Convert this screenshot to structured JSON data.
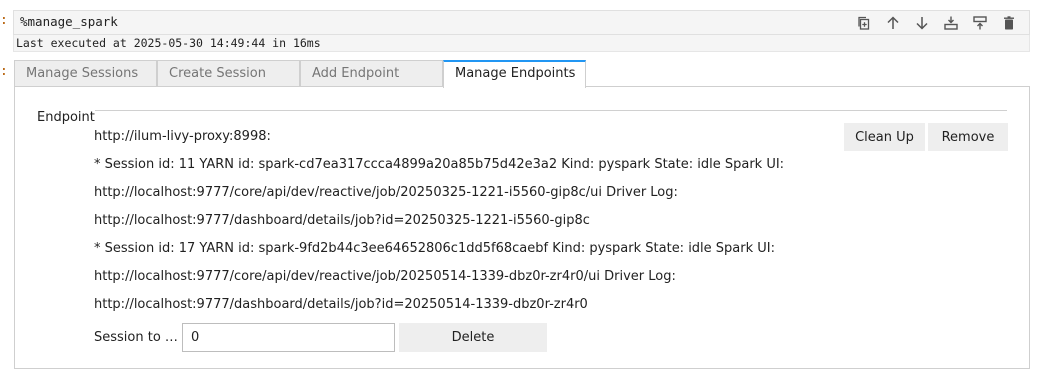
{
  "prompts": {
    "cell1": ":",
    "cell2": ":"
  },
  "code": {
    "text": "%manage_spark"
  },
  "exec": {
    "text": "Last executed at 2025-05-30 14:49:44 in 16ms"
  },
  "toolbar": {
    "icons": [
      "duplicate-icon",
      "arrow-up-icon",
      "arrow-down-icon",
      "insert-below-icon",
      "insert-above-icon",
      "trash-icon"
    ]
  },
  "tabs": [
    {
      "label": "Manage Sessions",
      "active": false
    },
    {
      "label": "Create Session",
      "active": false
    },
    {
      "label": "Add Endpoint",
      "active": false
    },
    {
      "label": "Manage Endpoints",
      "active": true
    }
  ],
  "panel": {
    "endpoint_label": "Endpoint",
    "lines": [
      "http://ilum-livy-proxy:8998:",
      "* Session id: 11 YARN id: spark-cd7ea317ccca4899a20a85b75d42e3a2 Kind: pyspark State: idle Spark UI:",
      "http://localhost:9777/core/api/dev/reactive/job/20250325-1221-i5560-gip8c/ui Driver Log:",
      "http://localhost:9777/dashboard/details/job?id=20250325-1221-i5560-gip8c",
      "* Session id: 17 YARN id: spark-9fd2b44c3ee64652806c1dd5f68caebf Kind: pyspark State: idle Spark UI:",
      "http://localhost:9777/core/api/dev/reactive/job/20250514-1339-dbz0r-zr4r0/ui Driver Log:",
      "http://localhost:9777/dashboard/details/job?id=20250514-1339-dbz0r-zr4r0"
    ],
    "cleanup_label": "Clean Up",
    "remove_label": "Remove",
    "session_label": "Session to …",
    "session_value": "0",
    "delete_label": "Delete"
  }
}
